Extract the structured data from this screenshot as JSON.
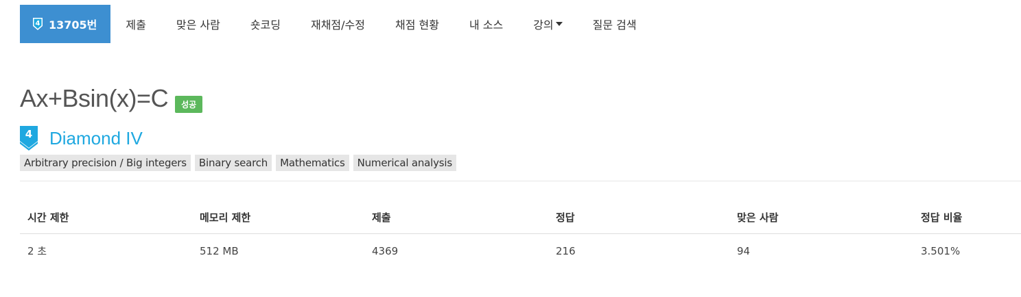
{
  "nav": {
    "problem_number": "13705번",
    "items": [
      {
        "name": "nav-submit",
        "label": "제출"
      },
      {
        "name": "nav-solved-users",
        "label": "맞은 사람"
      },
      {
        "name": "nav-shortest-code",
        "label": "숏코딩"
      },
      {
        "name": "nav-rejudge",
        "label": "재채점/수정"
      },
      {
        "name": "nav-status",
        "label": "채점 현황"
      },
      {
        "name": "nav-my-source",
        "label": "내 소스"
      },
      {
        "name": "nav-lecture",
        "label": "강의"
      },
      {
        "name": "nav-question-search",
        "label": "질문 검색"
      }
    ]
  },
  "problem": {
    "title": "Ax+Bsin(x)=C",
    "status_badge": "성공",
    "tier_number": "4",
    "tier_label": "Diamond IV",
    "tier_color": "#1fa8e0",
    "tags": [
      "Arbitrary precision / Big integers",
      "Binary search",
      "Mathematics",
      "Numerical analysis"
    ]
  },
  "info_table": {
    "headers": [
      "시간 제한",
      "메모리 제한",
      "제출",
      "정답",
      "맞은 사람",
      "정답 비율"
    ],
    "row": [
      "2 초",
      "512 MB",
      "4369",
      "216",
      "94",
      "3.501%"
    ]
  }
}
